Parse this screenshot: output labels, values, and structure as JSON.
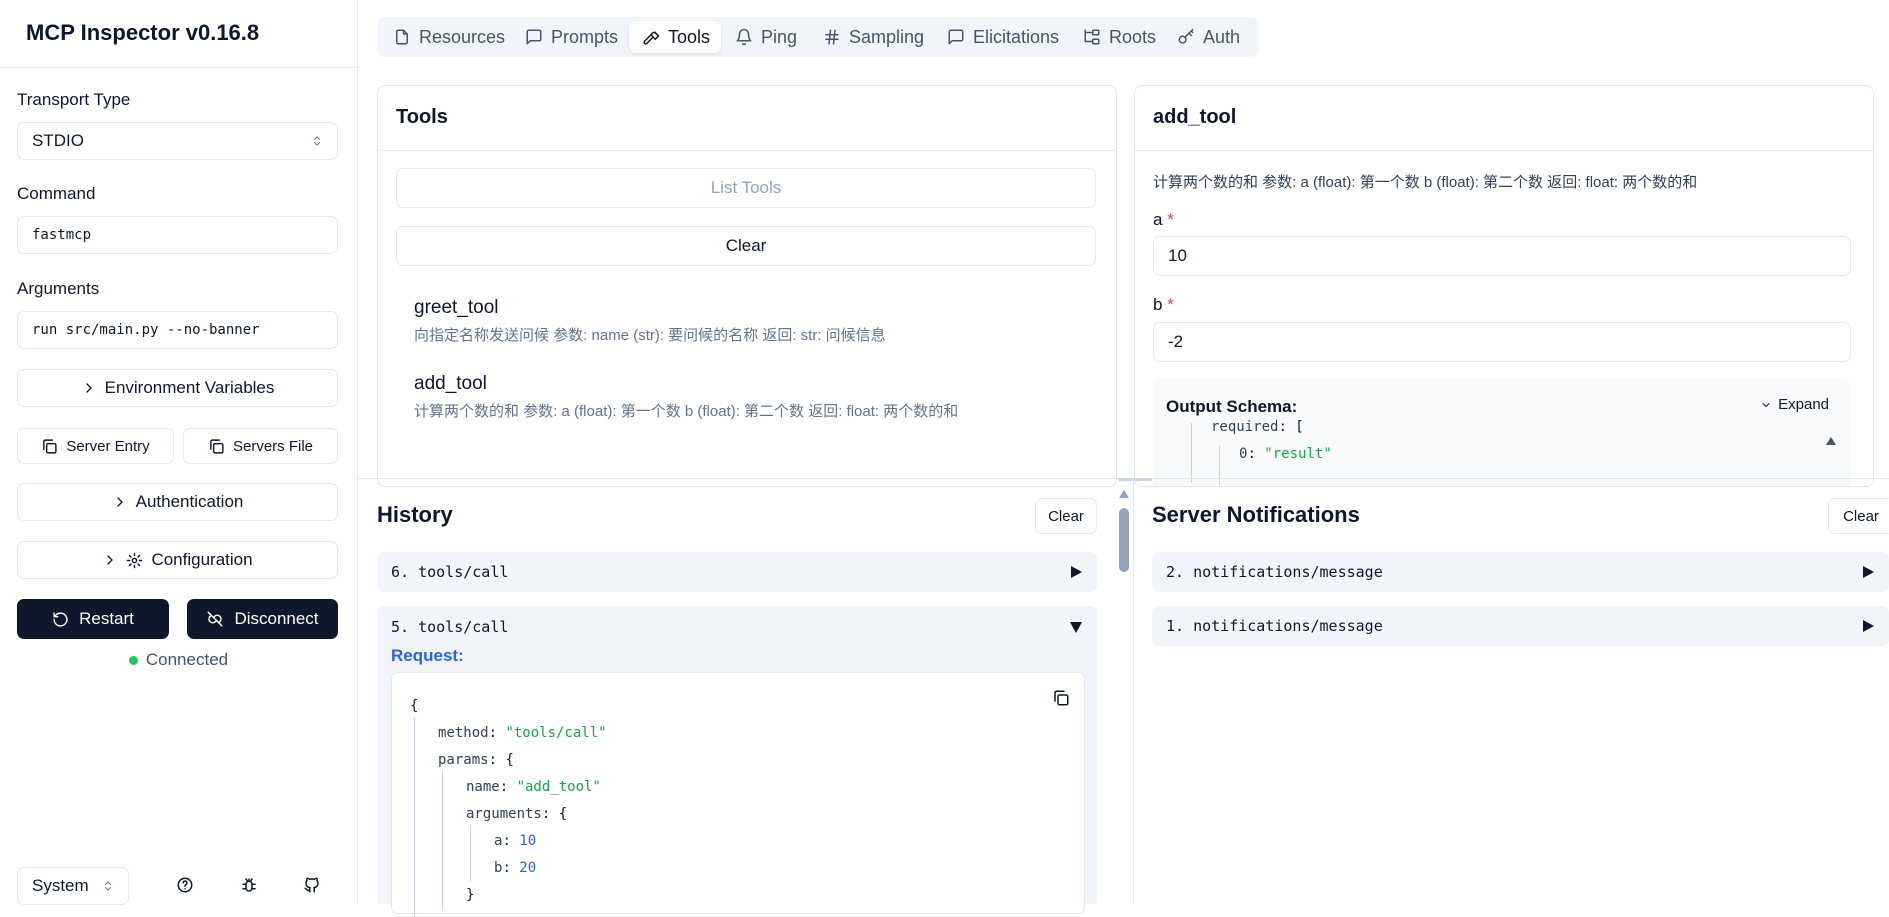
{
  "app": {
    "title": "MCP Inspector v0.16.8"
  },
  "sidebar": {
    "transport_label": "Transport Type",
    "transport_value": "STDIO",
    "command_label": "Command",
    "command_value": "fastmcp",
    "arguments_label": "Arguments",
    "arguments_value": "run src/main.py --no-banner",
    "env_vars": "Environment Variables",
    "server_entry": "Server Entry",
    "servers_file": "Servers File",
    "authentication": "Authentication",
    "configuration": "Configuration",
    "restart": "Restart",
    "disconnect": "Disconnect",
    "status": "Connected",
    "theme": "System"
  },
  "tabs": [
    {
      "label": "Resources",
      "icon": "file-icon"
    },
    {
      "label": "Prompts",
      "icon": "message-icon"
    },
    {
      "label": "Tools",
      "icon": "hammer-icon",
      "active": true
    },
    {
      "label": "Ping",
      "icon": "bell-icon"
    },
    {
      "label": "Sampling",
      "icon": "hash-icon"
    },
    {
      "label": "Elicitations",
      "icon": "message-icon"
    },
    {
      "label": "Roots",
      "icon": "folder-tree-icon"
    },
    {
      "label": "Auth",
      "icon": "key-icon"
    }
  ],
  "tools_panel": {
    "title": "Tools",
    "list_button": "List Tools",
    "clear_button": "Clear",
    "tools": [
      {
        "name": "greet_tool",
        "description": "向指定名称发送问候 参数: name (str): 要问候的名称 返回: str: 问候信息"
      },
      {
        "name": "add_tool",
        "description": "计算两个数的和 参数: a (float): 第一个数 b (float): 第二个数 返回: float: 两个数的和"
      }
    ]
  },
  "tool_detail": {
    "title": "add_tool",
    "description": "计算两个数的和 参数: a (float): 第一个数 b (float): 第二个数 返回: float: 两个数的和",
    "param_a_label": "a",
    "param_a_value": "10",
    "param_b_label": "b",
    "param_b_value": "-2",
    "required_mark": "*",
    "output_schema_label": "Output Schema:",
    "expand_label": "Expand",
    "schema_lines": {
      "required_key": "required",
      "bracket": "[",
      "item_key": "0",
      "item_value": "\"result\""
    }
  },
  "history": {
    "title": "History",
    "clear": "Clear",
    "items": [
      {
        "label": "6. tools/call"
      },
      {
        "label": "5. tools/call"
      }
    ],
    "request_label": "Request:",
    "request_json": {
      "open": "{",
      "method_key": "method",
      "method_val": "\"tools/call\"",
      "params_key": "params",
      "brace": "{",
      "name_key": "name",
      "name_val": "\"add_tool\"",
      "arguments_key": "arguments",
      "a_key": "a",
      "a_val": "10",
      "b_key": "b",
      "b_val": "20",
      "close": "}"
    }
  },
  "notifications": {
    "title": "Server Notifications",
    "clear": "Clear",
    "items": [
      {
        "label": "2. notifications/message"
      },
      {
        "label": "1. notifications/message"
      }
    ]
  }
}
